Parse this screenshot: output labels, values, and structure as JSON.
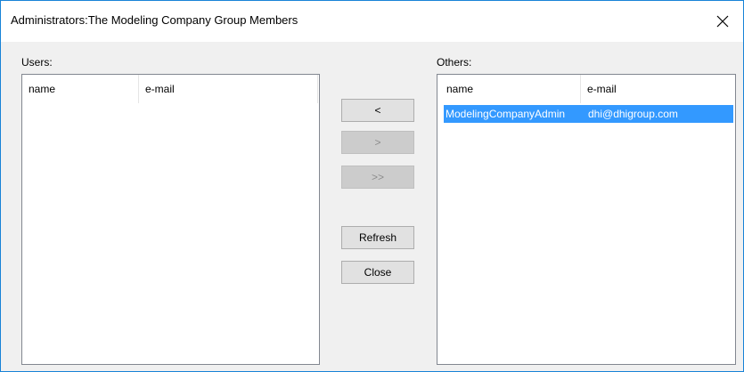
{
  "window": {
    "title": "Administrators:The Modeling Company Group Members",
    "close_icon": "close-icon"
  },
  "users": {
    "label": "Users:",
    "columns": [
      "name",
      "e-mail"
    ],
    "rows": []
  },
  "others": {
    "label": "Others:",
    "columns": [
      "name",
      "e-mail"
    ],
    "rows": [
      {
        "name": "ModelingCompanyAdmin",
        "email": "dhi@dhigroup.com",
        "selected": true
      }
    ]
  },
  "buttons": {
    "move_left": "<",
    "move_right": ">",
    "move_all_right": ">>",
    "refresh": "Refresh",
    "close": "Close"
  },
  "colors": {
    "selection": "#3399ff",
    "window_border": "#1883d7",
    "dialog_bg": "#f0f0f0"
  }
}
